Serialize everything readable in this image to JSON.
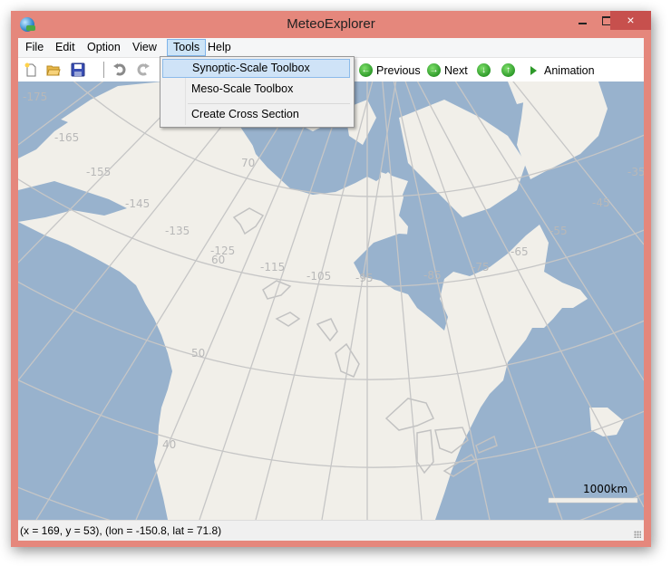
{
  "window": {
    "title": "MeteoExplorer",
    "controls": {
      "minimize": "minimize",
      "maximize": "maximize",
      "close": "×"
    }
  },
  "menubar": {
    "items": [
      {
        "label": "File"
      },
      {
        "label": "Edit"
      },
      {
        "label": "Option"
      },
      {
        "label": "View"
      },
      {
        "label": "Tools",
        "active": true
      },
      {
        "label": "Help"
      }
    ]
  },
  "tools_menu": {
    "items": [
      {
        "label": "Synoptic-Scale Toolbox",
        "highlighted": true
      },
      {
        "label": "Meso-Scale Toolbox"
      },
      {
        "label": "Create Cross Section"
      }
    ]
  },
  "toolbar": {
    "icons": [
      "new-file-icon",
      "open-folder-icon",
      "save-icon",
      "undo-icon",
      "redo-icon",
      "copy-icon"
    ],
    "previous_label": "Previous",
    "next_label": "Next",
    "down_label": "",
    "up_label": "",
    "animation_label": "Animation",
    "arrow_glyphs": {
      "previous": "←",
      "next": "→",
      "down": "↓",
      "up": "↑"
    }
  },
  "map": {
    "colors": {
      "ocean": "#98b2cd",
      "land": "#f1efe9",
      "grid": "#c6c6c6",
      "grid_label": "#b8b8b8",
      "lake_outline": "#c2c2c2"
    },
    "longitude_labels": [
      "-175",
      "-165",
      "-155",
      "-145",
      "-135",
      "-125",
      "-115",
      "-105",
      "-95",
      "-85",
      "-75",
      "-65",
      "-55",
      "-45",
      "-35"
    ],
    "latitude_labels": [
      "70",
      "60",
      "50",
      "40"
    ],
    "scale_bar_label": "1000km"
  },
  "statusbar": {
    "text": "(x = 169, y = 53), (lon = -150.8, lat = 71.8)"
  }
}
